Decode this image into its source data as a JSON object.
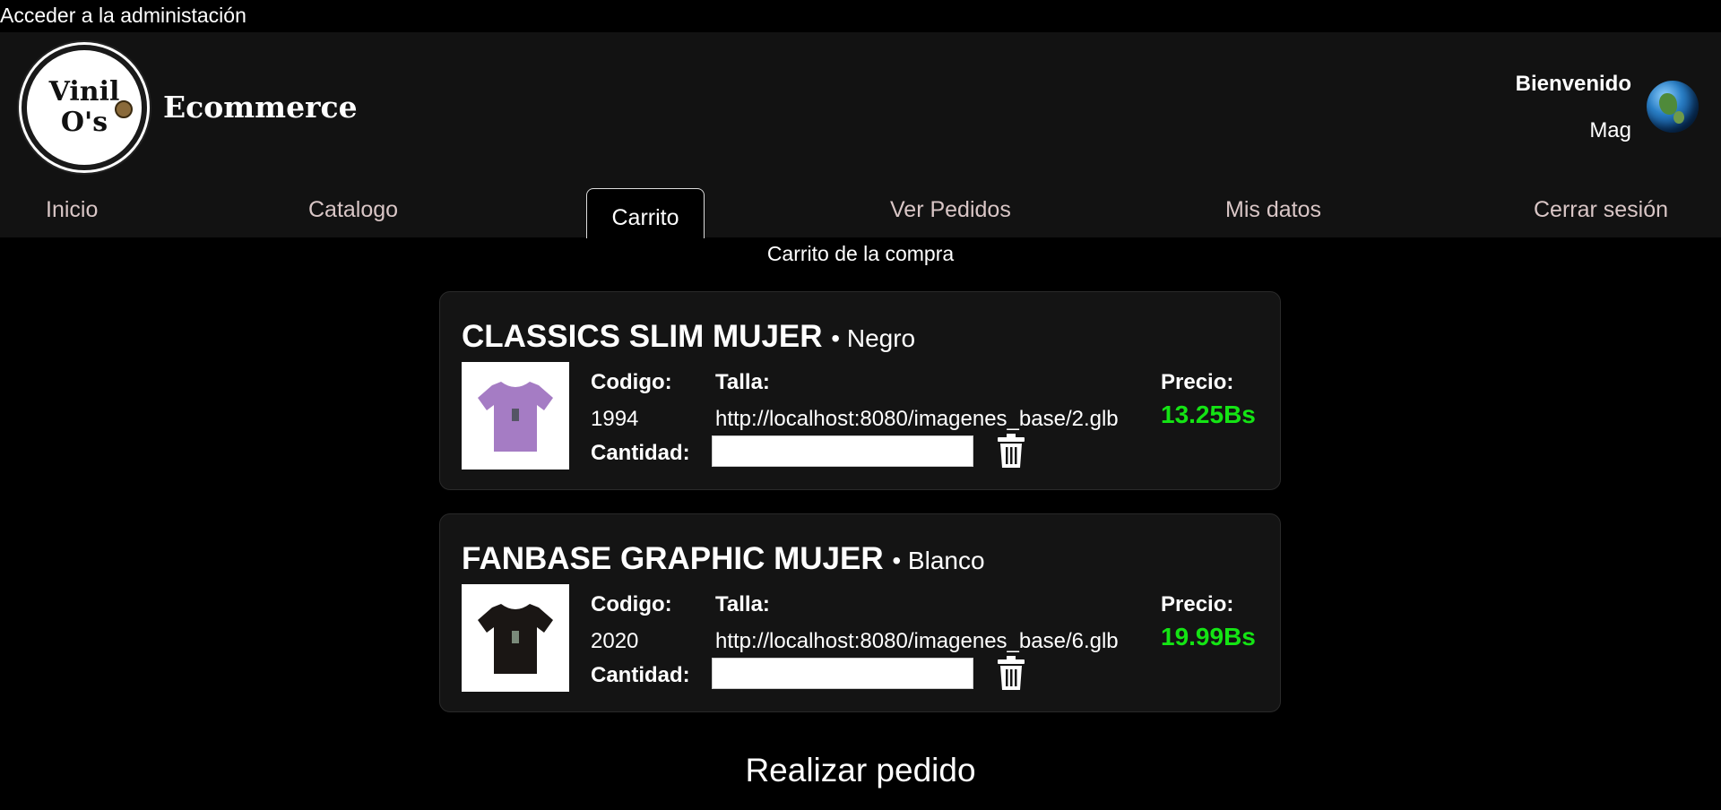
{
  "admin_link": "Acceder a la administación",
  "header": {
    "logo_text": "Vinil\nO's",
    "brand": "Ecommerce",
    "welcome": "Bienvenido",
    "username": "Mag"
  },
  "nav": {
    "items": [
      "Inicio",
      "Catalogo",
      "Carrito",
      "Ver Pedidos",
      "Mis datos",
      "Cerrar sesión"
    ],
    "active": "Carrito"
  },
  "page_title": "Carrito de la compra",
  "labels": {
    "code": "Codigo:",
    "size": "Talla:",
    "price": "Precio:",
    "quantity": "Cantidad:"
  },
  "cart_items": [
    {
      "name": "CLASSICS SLIM MUJER",
      "color": "• Negro",
      "code": "1994",
      "size": "http://localhost:8080/imagenes_base/2.glb",
      "price": "13.25Bs",
      "quantity": "",
      "shirt_color": "#a57cc4"
    },
    {
      "name": "FANBASE GRAPHIC MUJER",
      "color": "• Blanco",
      "code": "2020",
      "size": "http://localhost:8080/imagenes_base/6.glb",
      "price": "19.99Bs",
      "quantity": "",
      "shirt_color": "#1a1614"
    }
  ],
  "order_button": "Realizar pedido",
  "colors": {
    "background": "#000000",
    "header": "#121212",
    "price": "#14e414",
    "nav_text": "#d9c6c6"
  }
}
